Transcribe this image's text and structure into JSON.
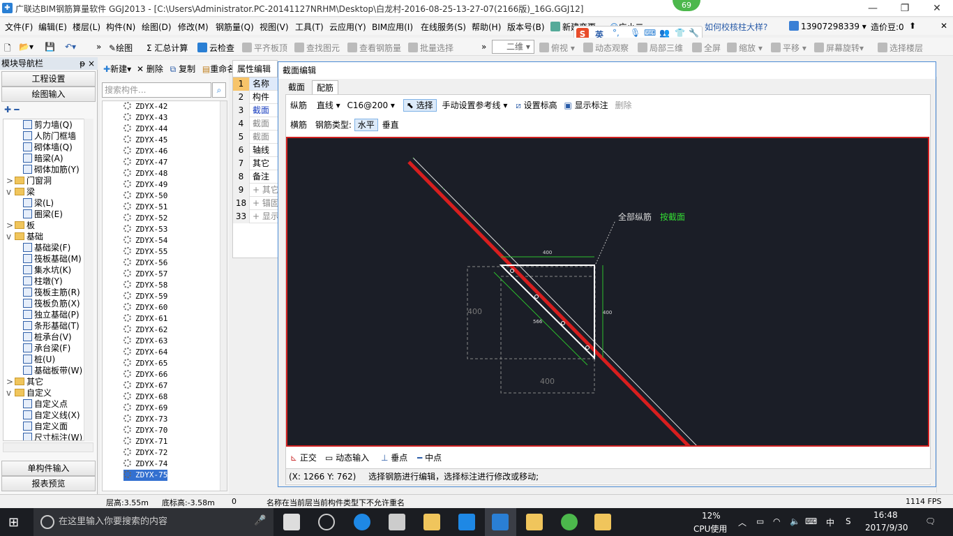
{
  "window": {
    "title": "广联达BIM钢筋算量软件 GGJ2013 - [C:\\Users\\Administrator.PC-20141127NRHM\\Desktop\\白龙村-2016-08-25-13-27-07(2166版)_16G.GGJ12]",
    "badge": "69",
    "min": "—",
    "max": "❐",
    "close": "✕"
  },
  "menu": [
    "文件(F)",
    "编辑(E)",
    "楼层(L)",
    "构件(N)",
    "绘图(D)",
    "修改(M)",
    "钢筋量(Q)",
    "视图(V)",
    "工具(T)",
    "云应用(Y)",
    "BIM应用(I)",
    "在线服务(S)",
    "帮助(H)",
    "版本号(B)"
  ],
  "menu_right": {
    "newchange": "新建变更",
    "assistant": "广小二",
    "hint": "如何校核柱大样?",
    "phone": "13907298339",
    "price": "造价豆:0"
  },
  "ime": {
    "logo": "S",
    "lang": "英"
  },
  "toolbar": {
    "draw": "绘图",
    "sum": "汇总计算",
    "cloud": "云检查",
    "align": "平齐板顶",
    "find": "查找图元",
    "view_rebar": "查看钢筋量",
    "batch": "批量选择",
    "view2d": "二维",
    "viewtop": "俯视",
    "dynamic": "动态观察",
    "local3d": "局部三维",
    "full": "全屏",
    "zoom": "缩放",
    "pan": "平移",
    "rotate": "屏幕旋转",
    "select_floor": "选择楼层"
  },
  "leftnav": {
    "header": "模块导航栏",
    "pin": "ᵽ ×",
    "btn1": "工程设置",
    "btn2": "绘图输入",
    "btn3": "单构件输入",
    "btn4": "报表预览",
    "tree": [
      {
        "indent": 2,
        "type": "item",
        "label": "剪力墙(Q)"
      },
      {
        "indent": 2,
        "type": "item",
        "label": "人防门框墙"
      },
      {
        "indent": 2,
        "type": "item",
        "label": "砌体墙(Q)"
      },
      {
        "indent": 2,
        "type": "item",
        "label": "暗梁(A)"
      },
      {
        "indent": 2,
        "type": "item",
        "label": "砌体加筋(Y)"
      },
      {
        "indent": 1,
        "type": "folder",
        "exp": ">",
        "label": "门窗洞"
      },
      {
        "indent": 1,
        "type": "folder",
        "exp": "v",
        "label": "梁"
      },
      {
        "indent": 2,
        "type": "item",
        "label": "梁(L)"
      },
      {
        "indent": 2,
        "type": "item",
        "label": "圈梁(E)"
      },
      {
        "indent": 1,
        "type": "folder",
        "exp": ">",
        "label": "板"
      },
      {
        "indent": 1,
        "type": "folder",
        "exp": "v",
        "label": "基础"
      },
      {
        "indent": 2,
        "type": "item",
        "label": "基础梁(F)"
      },
      {
        "indent": 2,
        "type": "item",
        "label": "筏板基础(M)"
      },
      {
        "indent": 2,
        "type": "item",
        "label": "集水坑(K)"
      },
      {
        "indent": 2,
        "type": "item",
        "label": "柱墩(Y)"
      },
      {
        "indent": 2,
        "type": "item",
        "label": "筏板主筋(R)"
      },
      {
        "indent": 2,
        "type": "item",
        "label": "筏板负筋(X)"
      },
      {
        "indent": 2,
        "type": "item",
        "label": "独立基础(P)"
      },
      {
        "indent": 2,
        "type": "item",
        "label": "条形基础(T)"
      },
      {
        "indent": 2,
        "type": "item",
        "label": "桩承台(V)"
      },
      {
        "indent": 2,
        "type": "item",
        "label": "承台梁(F)"
      },
      {
        "indent": 2,
        "type": "item",
        "label": "桩(U)"
      },
      {
        "indent": 2,
        "type": "item",
        "label": "基础板带(W)"
      },
      {
        "indent": 1,
        "type": "folder",
        "exp": ">",
        "label": "其它"
      },
      {
        "indent": 1,
        "type": "folder",
        "exp": "v",
        "label": "自定义"
      },
      {
        "indent": 2,
        "type": "item",
        "label": "自定义点"
      },
      {
        "indent": 2,
        "type": "item",
        "label": "自定义线(X)"
      },
      {
        "indent": 2,
        "type": "item",
        "label": "自定义面"
      },
      {
        "indent": 2,
        "type": "item",
        "label": "尺寸标注(W)"
      }
    ]
  },
  "mid": {
    "new": "新建",
    "delete": "删除",
    "copy": "复制",
    "rename": "重命名",
    "floor": "楼层",
    "search_placeholder": "搜索构件...",
    "items": [
      "ZDYX-42",
      "ZDYX-43",
      "ZDYX-44",
      "ZDYX-45",
      "ZDYX-46",
      "ZDYX-47",
      "ZDYX-48",
      "ZDYX-49",
      "ZDYX-50",
      "ZDYX-51",
      "ZDYX-52",
      "ZDYX-53",
      "ZDYX-54",
      "ZDYX-55",
      "ZDYX-56",
      "ZDYX-57",
      "ZDYX-58",
      "ZDYX-59",
      "ZDYX-60",
      "ZDYX-61",
      "ZDYX-62",
      "ZDYX-63",
      "ZDYX-64",
      "ZDYX-65",
      "ZDYX-66",
      "ZDYX-67",
      "ZDYX-68",
      "ZDYX-69",
      "ZDYX-73",
      "ZDYX-70",
      "ZDYX-71",
      "ZDYX-72",
      "ZDYX-74",
      "ZDYX-75"
    ],
    "selected": "ZDYX-75"
  },
  "props": {
    "tab": "属性编辑",
    "rows": [
      {
        "n": "1",
        "t": "名称"
      },
      {
        "n": "2",
        "t": "构件"
      },
      {
        "n": "3",
        "t": "截面"
      },
      {
        "n": "4",
        "t": "截面"
      },
      {
        "n": "5",
        "t": "截面"
      },
      {
        "n": "6",
        "t": "轴线"
      },
      {
        "n": "7",
        "t": "其它"
      },
      {
        "n": "8",
        "t": "备注"
      },
      {
        "n": "9",
        "t": "+ 其它"
      },
      {
        "n": "18",
        "t": "+ 锚固"
      },
      {
        "n": "33",
        "t": "+ 显示"
      }
    ]
  },
  "dialog": {
    "title": "截面编辑",
    "tab1": "截面",
    "tab2": "配筋",
    "long_label": "纵筋",
    "line_type": "直线",
    "spec": "C16@200",
    "select": "选择",
    "manual_ref": "手动设置参考线",
    "set_elev": "设置标高",
    "show_dim": "显示标注",
    "delete": "删除",
    "trans_label": "横筋",
    "rebar_type": "钢筋类型:",
    "horizontal": "水平",
    "vertical": "垂直",
    "annot_all": "全部纵筋",
    "annot_by": "按截面",
    "dim_top": "400",
    "dim_right": "400",
    "dim_diag": "566",
    "dim_left": "400",
    "dim_bottom": "400",
    "bottom": {
      "ortho": "正交",
      "dyn": "动态输入",
      "perp": "垂点",
      "mid": "中点"
    },
    "status_coords": "(X: 1266 Y: 762)",
    "status_msg": "选择钢筋进行编辑，选择标注进行修改或移动;"
  },
  "statusbar": {
    "floor_h": "层高:3.55m",
    "base_h": "底标高:-3.58m",
    "zero": "0",
    "msg": "名称在当前层当前构件类型下不允许重名",
    "fps": "1114 FPS"
  },
  "taskbar": {
    "search": "在这里输入你要搜索的内容",
    "cpu_pct": "12%",
    "cpu_label": "CPU使用",
    "time": "16:48",
    "date": "2017/9/30"
  }
}
